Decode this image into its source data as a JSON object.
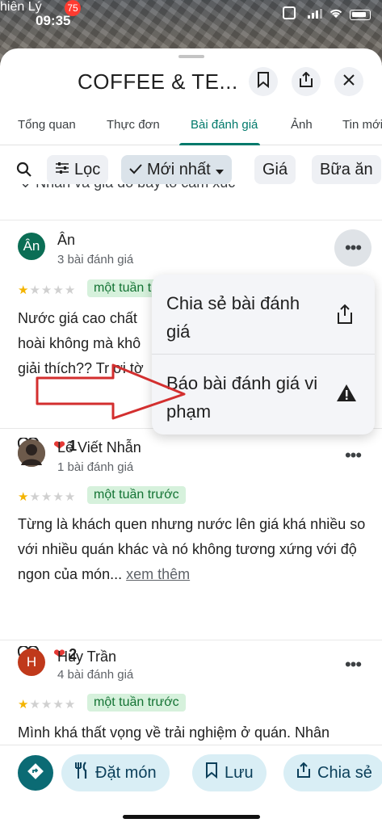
{
  "status_bar": {
    "carrier": "hiên Lý",
    "time": "09:35",
    "pin_badge": "75"
  },
  "header": {
    "title": "COFFEE & TE..."
  },
  "tabs": [
    {
      "label": "Tổng quan"
    },
    {
      "label": "Thực đơn"
    },
    {
      "label": "Bài đánh giá"
    },
    {
      "label": "Ảnh"
    },
    {
      "label": "Tin mới"
    }
  ],
  "filters": {
    "filter": "Lọc",
    "sort": "Mới nhất",
    "price": "Giá",
    "meal": "Bữa ăn"
  },
  "partial_text": "Nhân và giá do bày tỏ cảm xúc",
  "reviews": [
    {
      "initial": "Ân",
      "name": "Ân",
      "count": "3 bài đánh giá",
      "rating": 1,
      "date": "một tuần trước",
      "text": "Nước giá cao chất hoài không mà khô giải thích?? Tr ơi tờ",
      "reactions": "1",
      "avatar_color": "#0b6e55"
    },
    {
      "initial": "",
      "name": "Lê Viết Nhẫn",
      "count": "1 bài đánh giá",
      "rating": 1,
      "date": "một tuần trước",
      "text": "Từng là khách quen nhưng nước lên giá khá nhiều so với nhiều quán khác và nó không tương xứng với độ ngon của món...",
      "see_more": "xem thêm",
      "reactions": "2",
      "avatar_color": "#4a3d35"
    },
    {
      "initial": "H",
      "name": "Huy Trần",
      "count": "4 bài đánh giá",
      "rating": 1,
      "date": "một tuần trước",
      "text": "Mình khá thất vọng về trải nghiệm ở quán. Nhân",
      "avatar_color": "#c0391b"
    }
  ],
  "menu": {
    "share": "Chia sẻ bài đánh giá",
    "report": "Báo bài đánh giá vi phạm"
  },
  "bottom": {
    "order": "Đặt món",
    "save": "Lưu",
    "share": "Chia sẻ"
  },
  "colors": {
    "accent": "#00796b",
    "date_bg": "#d6f1dc",
    "button_bg": "#d9eef5",
    "arrow": "#d32f2f"
  }
}
